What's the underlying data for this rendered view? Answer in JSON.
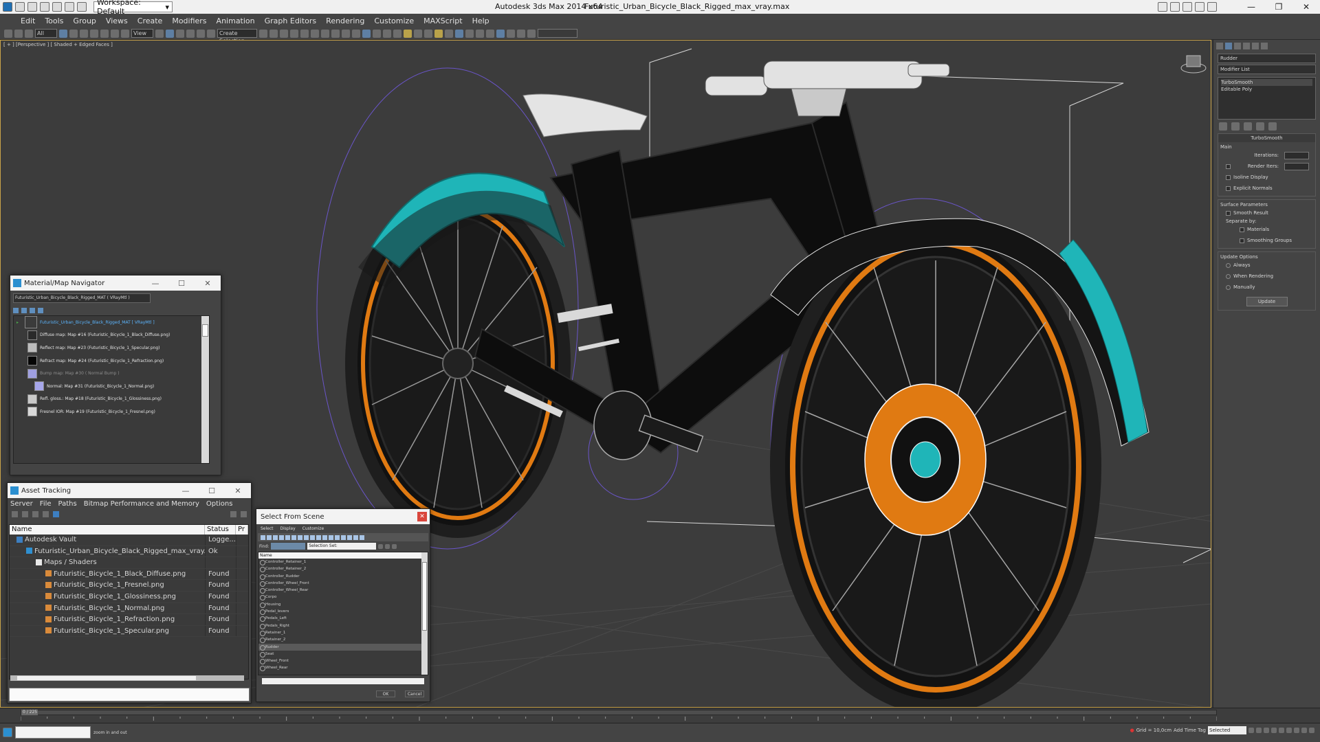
{
  "titlebar": {
    "workspace_label": "Workspace: Default",
    "app_title": "Autodesk 3ds Max  2014 x64",
    "file_title": "Futuristic_Urban_Bicycle_Black_Rigged_max_vray.max"
  },
  "menubar": [
    "Edit",
    "Tools",
    "Group",
    "Views",
    "Create",
    "Modifiers",
    "Animation",
    "Graph Editors",
    "Rendering",
    "Customize",
    "MAXScript",
    "Help"
  ],
  "toolbar": {
    "selection_filter": "All",
    "ref_coord": "View",
    "named_sel": "Create Selection"
  },
  "viewport": {
    "label": "[ + ] [Perspective ] [ Shaded + Edged Faces ]"
  },
  "command_panel": {
    "object_name": "Rudder",
    "modifier_list": "Modifier List",
    "stack": [
      "TurboSmooth",
      "Editable Poly"
    ],
    "turbosmooth": {
      "title": "TurboSmooth",
      "main": "Main",
      "iterations": "Iterations:",
      "render_iters": "Render Iters:",
      "isoline": "Isoline Display",
      "explicit": "Explicit Normals",
      "surface": "Surface Parameters",
      "smooth_result": "Smooth Result",
      "separate_by": "Separate by:",
      "materials": "Materials",
      "smoothing_groups": "Smoothing Groups",
      "update_options": "Update Options",
      "always": "Always",
      "when_rendering": "When Rendering",
      "manually": "Manually",
      "update": "Update"
    }
  },
  "material_navigator": {
    "title": "Material/Map Navigator",
    "name_field": "Futuristic_Urban_Bicycle_Black_Rigged_MAT  ( VRayMtl )",
    "items": [
      {
        "label": "Futuristic_Urban_Bicycle_Black_Rigged_MAT  [ VRayMtl ]",
        "color": "#3b3b3b"
      },
      {
        "label": "Diffuse map: Map #16 (Futuristic_Bicycle_1_Black_Diffuse.png)",
        "color": "#2a2a2a"
      },
      {
        "label": "Reflect map: Map #23 (Futuristic_Bicycle_1_Specular.png)",
        "color": "#bdbdbd"
      },
      {
        "label": "Refract map: Map #24 (Futuristic_Bicycle_1_Refraction.png)",
        "color": "#050505"
      },
      {
        "label": "Bump map: Map #30 ( Normal Bump )",
        "color": "#9f9fe0"
      },
      {
        "label": "Normal: Map #31 (Futuristic_Bicycle_1_Normal.png)",
        "color": "#a6a6ea"
      },
      {
        "label": "Refl. gloss.: Map #18 (Futuristic_Bicycle_1_Glossiness.png)",
        "color": "#c9c9c9"
      },
      {
        "label": "Fresnel IOR: Map #19 (Futuristic_Bicycle_1_Fresnel.png)",
        "color": "#d8d8d8"
      }
    ]
  },
  "asset_tracking": {
    "title": "Asset Tracking",
    "menu": [
      "Server",
      "File",
      "Paths",
      "Bitmap Performance and Memory",
      "Options"
    ],
    "columns": [
      "Name",
      "Status",
      "Pr"
    ],
    "rows": [
      {
        "name": "Autodesk Vault",
        "status": "Logge...",
        "indent": 1,
        "icon": "#3d7fc1"
      },
      {
        "name": "Futuristic_Urban_Bicycle_Black_Rigged_max_vray.max",
        "status": "Ok",
        "indent": 2,
        "icon": "#2f8fd0"
      },
      {
        "name": "Maps / Shaders",
        "status": "",
        "indent": 3,
        "icon": "#e8e8e8"
      },
      {
        "name": "Futuristic_Bicycle_1_Black_Diffuse.png",
        "status": "Found",
        "indent": 4,
        "icon": "#d98a3a"
      },
      {
        "name": "Futuristic_Bicycle_1_Fresnel.png",
        "status": "Found",
        "indent": 4,
        "icon": "#d98a3a"
      },
      {
        "name": "Futuristic_Bicycle_1_Glossiness.png",
        "status": "Found",
        "indent": 4,
        "icon": "#d98a3a"
      },
      {
        "name": "Futuristic_Bicycle_1_Normal.png",
        "status": "Found",
        "indent": 4,
        "icon": "#d98a3a"
      },
      {
        "name": "Futuristic_Bicycle_1_Refraction.png",
        "status": "Found",
        "indent": 4,
        "icon": "#d98a3a"
      },
      {
        "name": "Futuristic_Bicycle_1_Specular.png",
        "status": "Found",
        "indent": 4,
        "icon": "#d98a3a"
      }
    ]
  },
  "select_from_scene": {
    "title": "Select From Scene",
    "menu": [
      "Select",
      "Display",
      "Customize"
    ],
    "find_label": "Find:",
    "selection_set": "Selection Set:",
    "column": "Name",
    "items": [
      "Controller_Retainer_1",
      "Controller_Retainer_2",
      "Controller_Rudder",
      "Controller_Wheel_Front",
      "Controller_Wheel_Rear",
      "Corpo",
      "Housing",
      "Pedal_levers",
      "Pedals_Left",
      "Pedals_Right",
      "Retainer_1",
      "Retainer_2",
      "Rudder",
      "Seat",
      "Wheel_Front",
      "Wheel_Rear"
    ],
    "highlighted": "Rudder",
    "ok": "OK",
    "cancel": "Cancel"
  },
  "timeline": {
    "frame_label": "0 / 225"
  },
  "statusbar": {
    "selection_mode": "Selected",
    "prompt": "zoom in and out",
    "grid": "Grid = 10,0cm",
    "add_time_tag": "Add Time Tag"
  },
  "colors": {
    "accent_teal": "#1fb5b8",
    "accent_orange": "#e07a12",
    "viewport_bg": "#3c3c3c",
    "panel_bg": "#444444"
  }
}
